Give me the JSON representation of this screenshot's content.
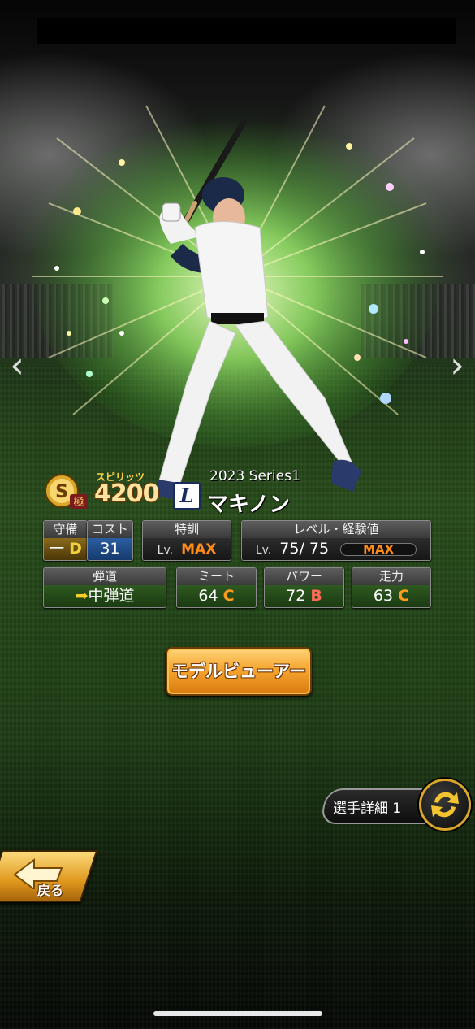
{
  "header": {
    "status_bar": ""
  },
  "card": {
    "rank_letter": "S",
    "rank_sub": "極",
    "spirits_label": "スピリッツ",
    "spirits_value": "4200",
    "team_logo": "L",
    "series": "2023 Series1",
    "player_name": "マキノン"
  },
  "stats": {
    "position": {
      "label": "守備",
      "value": "一",
      "grade": "D"
    },
    "cost": {
      "label": "コスト",
      "value": "31"
    },
    "special_training": {
      "label": "特訓",
      "lv": "Lv.",
      "value": "MAX"
    },
    "level_exp": {
      "label": "レベル・経験値",
      "lv": "Lv.",
      "current": "75/",
      "max_level": "75",
      "exp_value": "MAX",
      "exp_fill": 1.0
    },
    "trajectory": {
      "label": "弾道",
      "value": "中弾道"
    },
    "contact": {
      "label": "ミート",
      "value": "64",
      "grade": "C"
    },
    "power": {
      "label": "パワー",
      "value": "72",
      "grade": "B"
    },
    "speed": {
      "label": "走力",
      "value": "63",
      "grade": "C"
    }
  },
  "buttons": {
    "model_viewer": "モデルビューアー",
    "player_detail": "選手詳細 1",
    "back": "戻る"
  },
  "icons": {
    "prev": "chevron-left-icon",
    "next": "chevron-right-icon",
    "swap": "swap-arrows-icon",
    "back": "back-arrow-icon",
    "trajectory": "arrow-icon"
  },
  "colors": {
    "accent_gold": "#f6a630",
    "grade_c": "#ff9c1a",
    "grade_b": "#ff6a5a",
    "max_orange": "#ff8c1a"
  }
}
